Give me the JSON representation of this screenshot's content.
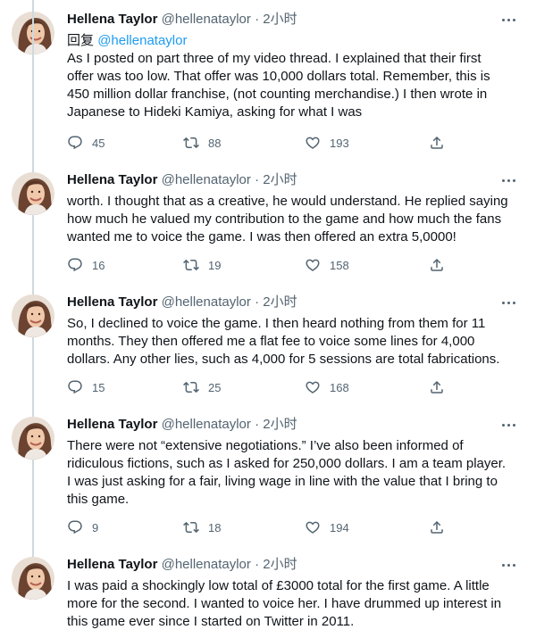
{
  "tweets": [
    {
      "name": "Hellena Taylor",
      "handle": "@hellenataylor",
      "time": "2小时",
      "replying_label": "回复",
      "replying_to": "@hellenataylor",
      "text": "As I posted on part three of my video thread.  I explained that their first\noffer was too low.  That offer was 10,000 dollars total.  Remember, this is\n450 million dollar franchise, (not counting merchandise.)  I then wrote in\nJapanese to Hideki Kamiya, asking for what I was",
      "replies": "45",
      "retweets": "88",
      "likes": "193"
    },
    {
      "name": "Hellena Taylor",
      "handle": "@hellenataylor",
      "time": "2小时",
      "text": "worth.  I thought that as a creative, he would understand.  He replied saying\nhow much he valued my contribution to the game and how much the fans\nwanted me to voice the game.  I was then offered an extra 5,0000!",
      "replies": "16",
      "retweets": "19",
      "likes": "158"
    },
    {
      "name": "Hellena Taylor",
      "handle": "@hellenataylor",
      "time": "2小时",
      "text": "So, I declined to voice the game.  I then heard nothing from them for 11\nmonths.  They then offered me a flat fee to voice some lines for 4,000\ndollars.  Any other lies, such as 4,000 for 5 sessions are total fabrications.",
      "replies": "15",
      "retweets": "25",
      "likes": "168"
    },
    {
      "name": "Hellena Taylor",
      "handle": "@hellenataylor",
      "time": "2小时",
      "text": "There were not “extensive negotiations.”  I’ve also been informed of\nridiculous fictions, such as I asked for 250,000 dollars.  I am a team player.\nI was just asking for a fair, living wage in line with the value that I bring to\nthis game.",
      "replies": "9",
      "retweets": "18",
      "likes": "194"
    },
    {
      "name": "Hellena Taylor",
      "handle": "@hellenataylor",
      "time": "2小时",
      "text": "I was paid a shockingly low total of £3000 total for the first game.  A little\nmore for the second.  I wanted to voice her.  I have drummed up interest in\nthis game ever since I started on Twitter in 2011."
    }
  ]
}
